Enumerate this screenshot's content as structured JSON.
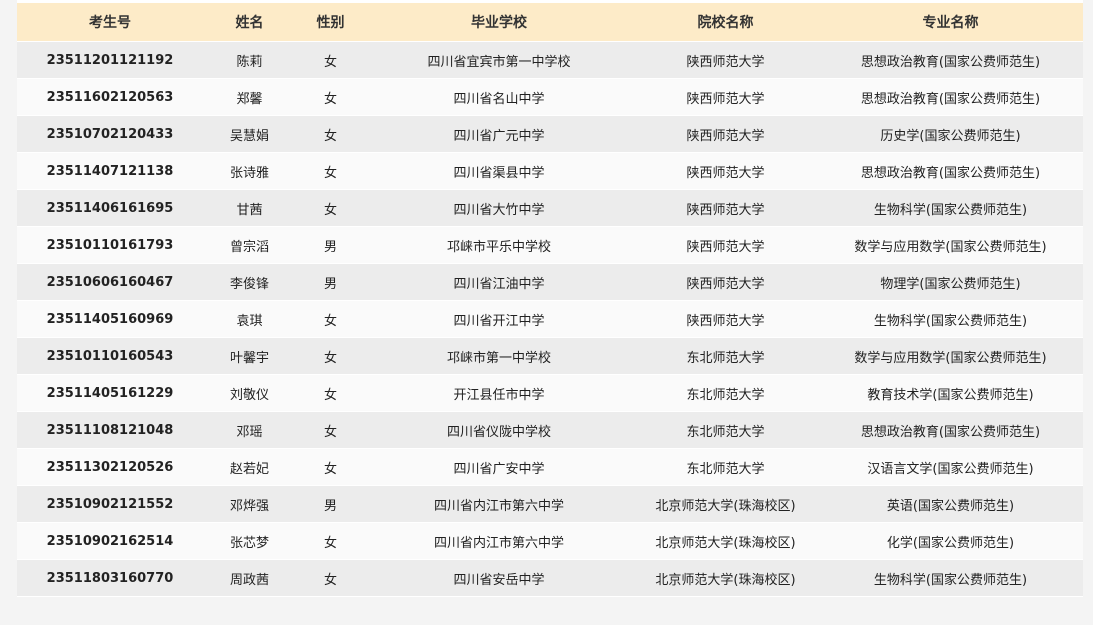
{
  "table": {
    "headers": [
      "考生号",
      "姓名",
      "性别",
      "毕业学校",
      "院校名称",
      "专业名称"
    ],
    "rows": [
      [
        "23511201121192",
        "陈莉",
        "女",
        "四川省宜宾市第一中学校",
        "陕西师范大学",
        "思想政治教育(国家公费师范生)"
      ],
      [
        "23511602120563",
        "郑馨",
        "女",
        "四川省名山中学",
        "陕西师范大学",
        "思想政治教育(国家公费师范生)"
      ],
      [
        "23510702120433",
        "吴慧娟",
        "女",
        "四川省广元中学",
        "陕西师范大学",
        "历史学(国家公费师范生)"
      ],
      [
        "23511407121138",
        "张诗雅",
        "女",
        "四川省渠县中学",
        "陕西师范大学",
        "思想政治教育(国家公费师范生)"
      ],
      [
        "23511406161695",
        "甘茜",
        "女",
        "四川省大竹中学",
        "陕西师范大学",
        "生物科学(国家公费师范生)"
      ],
      [
        "23510110161793",
        "曾宗滔",
        "男",
        "邛崃市平乐中学校",
        "陕西师范大学",
        "数学与应用数学(国家公费师范生)"
      ],
      [
        "23510606160467",
        "李俊锋",
        "男",
        "四川省江油中学",
        "陕西师范大学",
        "物理学(国家公费师范生)"
      ],
      [
        "23511405160969",
        "袁琪",
        "女",
        "四川省开江中学",
        "陕西师范大学",
        "生物科学(国家公费师范生)"
      ],
      [
        "23510110160543",
        "叶馨宇",
        "女",
        "邛崃市第一中学校",
        "东北师范大学",
        "数学与应用数学(国家公费师范生)"
      ],
      [
        "23511405161229",
        "刘敬仪",
        "女",
        "开江县任市中学",
        "东北师范大学",
        "教育技术学(国家公费师范生)"
      ],
      [
        "23511108121048",
        "邓瑶",
        "女",
        "四川省仪陇中学校",
        "东北师范大学",
        "思想政治教育(国家公费师范生)"
      ],
      [
        "23511302120526",
        "赵若妃",
        "女",
        "四川省广安中学",
        "东北师范大学",
        "汉语言文学(国家公费师范生)"
      ],
      [
        "23510902121552",
        "邓烨强",
        "男",
        "四川省内江市第六中学",
        "北京师范大学(珠海校区)",
        "英语(国家公费师范生)"
      ],
      [
        "23510902162514",
        "张芯梦",
        "女",
        "四川省内江市第六中学",
        "北京师范大学(珠海校区)",
        "化学(国家公费师范生)"
      ],
      [
        "23511803160770",
        "周政茜",
        "女",
        "四川省安岳中学",
        "北京师范大学(珠海校区)",
        "生物科学(国家公费师范生)"
      ]
    ]
  },
  "colors": {
    "header_bg": "#fdebc8",
    "row_odd_bg": "#ececec",
    "row_even_bg": "#fafafa",
    "page_bg": "#f4f4f4"
  }
}
